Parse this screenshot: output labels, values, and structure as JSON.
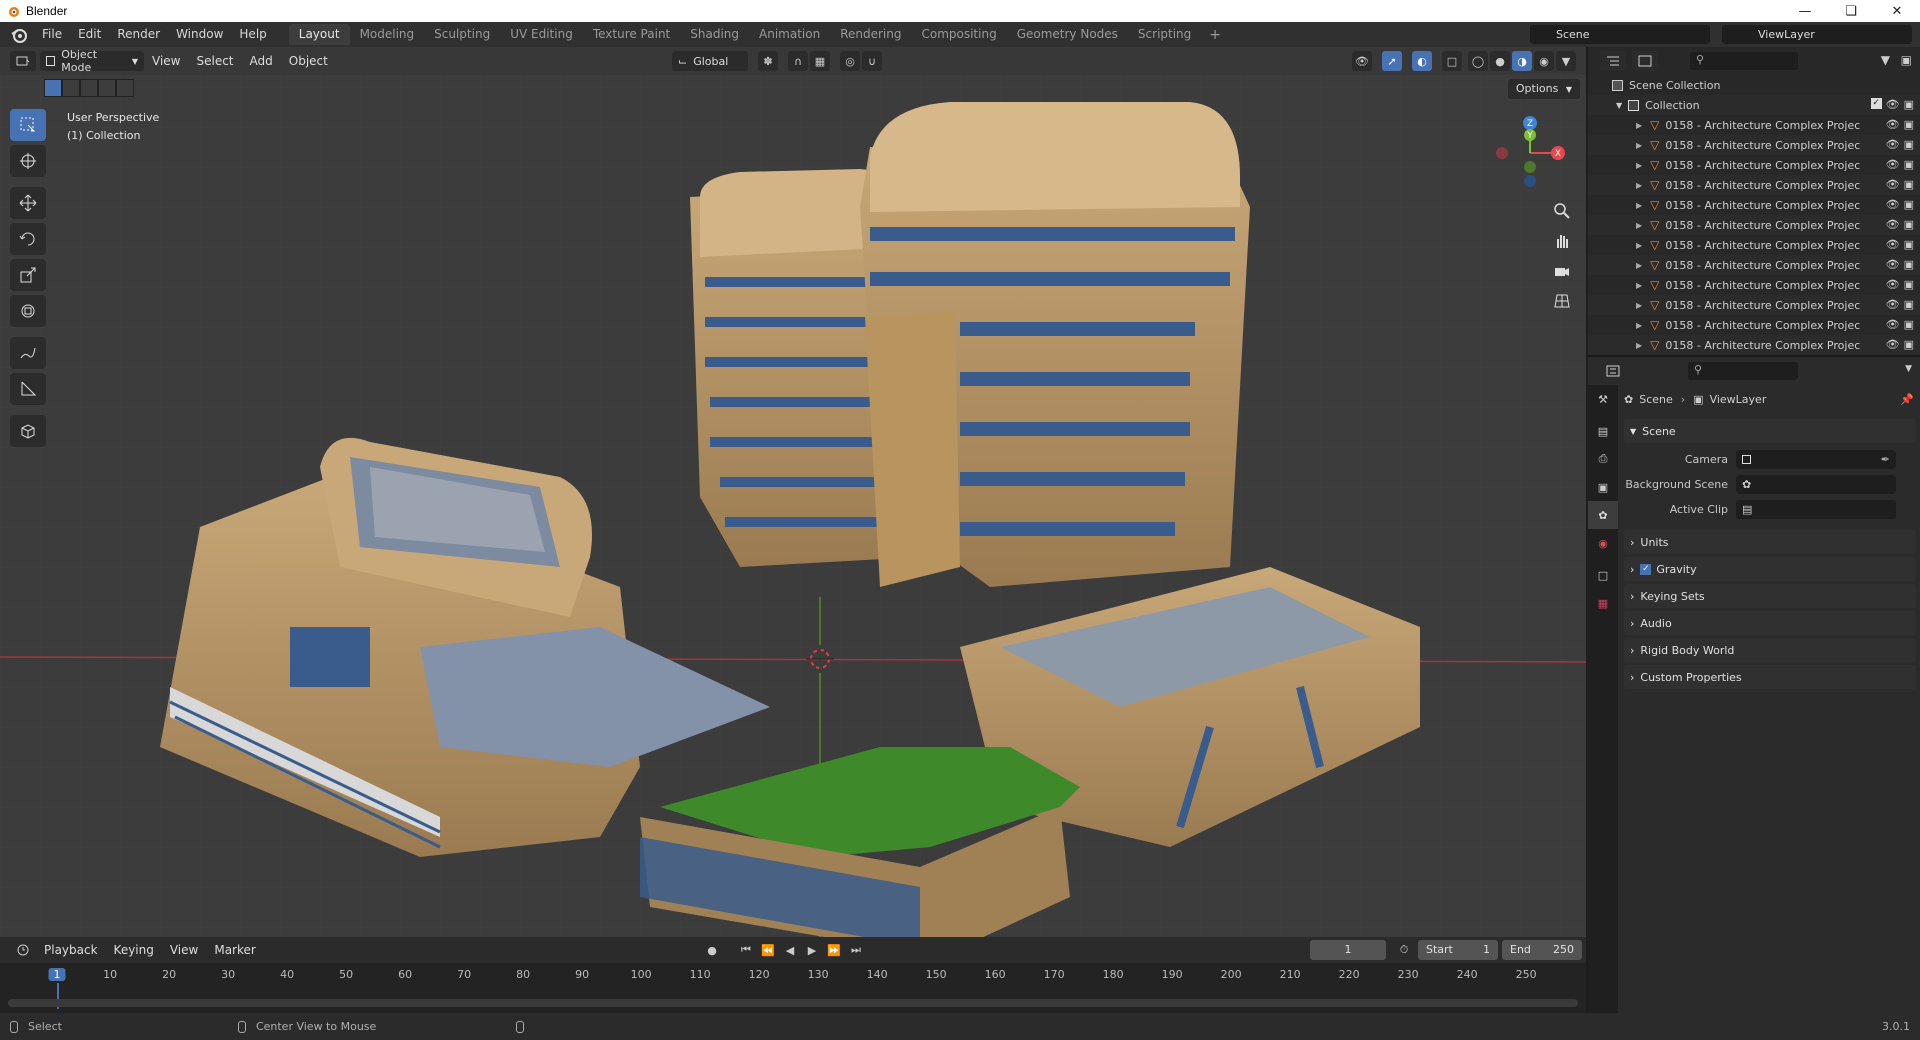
{
  "window": {
    "title": "Blender"
  },
  "menu": [
    "File",
    "Edit",
    "Render",
    "Window",
    "Help"
  ],
  "workspaces": [
    "Layout",
    "Modeling",
    "Sculpting",
    "UV Editing",
    "Texture Paint",
    "Shading",
    "Animation",
    "Rendering",
    "Compositing",
    "Geometry Nodes",
    "Scripting"
  ],
  "active_workspace": "Layout",
  "scene_selector": {
    "label": "Scene"
  },
  "viewlayer_selector": {
    "label": "ViewLayer"
  },
  "viewport": {
    "mode": "Object Mode",
    "menus": [
      "View",
      "Select",
      "Add",
      "Object"
    ],
    "orientation": "Global",
    "options_label": "Options",
    "info_line1": "User Perspective",
    "info_line2": "(1) Collection",
    "gizmo_axes": {
      "x": "X",
      "y": "Y",
      "z": "Z"
    }
  },
  "outliner": {
    "scene_collection": "Scene Collection",
    "collection": "Collection",
    "items": [
      "0158 - Architecture Complex Projec",
      "0158 - Architecture Complex Projec",
      "0158 - Architecture Complex Projec",
      "0158 - Architecture Complex Projec",
      "0158 - Architecture Complex Projec",
      "0158 - Architecture Complex Projec",
      "0158 - Architecture Complex Projec",
      "0158 - Architecture Complex Projec",
      "0158 - Architecture Complex Projec",
      "0158 - Architecture Complex Projec",
      "0158 - Architecture Complex Projec",
      "0158 - Architecture Complex Projec"
    ]
  },
  "properties": {
    "breadcrumb_scene": "Scene",
    "breadcrumb_viewlayer": "ViewLayer",
    "panel_scene": "Scene",
    "camera_label": "Camera",
    "background_scene_label": "Background Scene",
    "active_clip_label": "Active Clip",
    "panels": [
      "Units",
      "Gravity",
      "Keying Sets",
      "Audio",
      "Rigid Body World",
      "Custom Properties"
    ],
    "gravity_checked": true
  },
  "timeline": {
    "menus": [
      "Playback",
      "Keying",
      "View",
      "Marker"
    ],
    "current_frame": "1",
    "start_label": "Start",
    "start_value": "1",
    "end_label": "End",
    "end_value": "250",
    "ruler": [
      "1",
      "10",
      "20",
      "30",
      "40",
      "50",
      "60",
      "70",
      "80",
      "90",
      "100",
      "110",
      "120",
      "130",
      "140",
      "150",
      "160",
      "170",
      "180",
      "190",
      "200",
      "210",
      "220",
      "230",
      "240",
      "250"
    ]
  },
  "statusbar": {
    "select": "Select",
    "center_view": "Center View to Mouse",
    "version": "3.0.1"
  },
  "colors": {
    "accent": "#4772b3",
    "object_orange": "#e8873a",
    "axis_red": "#e8474f",
    "axis_green": "#7bbf3a",
    "axis_blue": "#3f84d6"
  }
}
